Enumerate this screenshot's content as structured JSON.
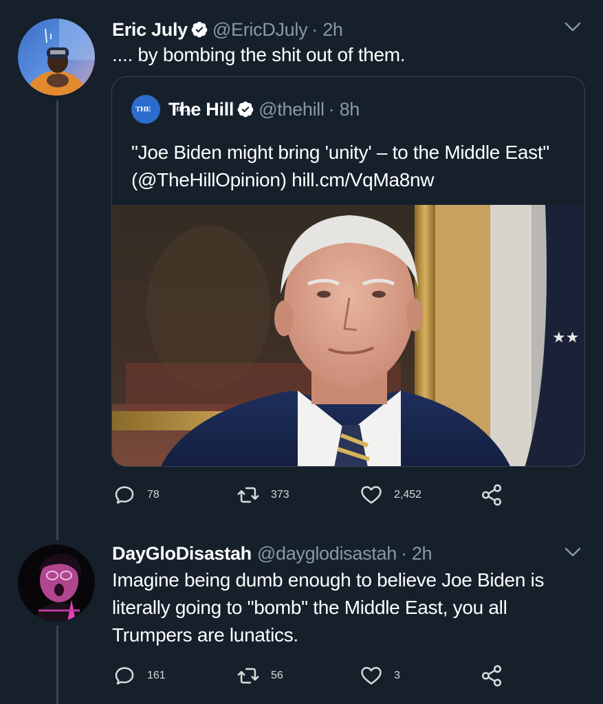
{
  "tweets": [
    {
      "display_name": "Eric July",
      "handle": "@EricDJuly",
      "time": "· 2h",
      "text": ".... by bombing the shit out of them.",
      "quote": {
        "display_name": "The Hill",
        "handle": "@thehill",
        "time": "· 8h",
        "logo_text": "THE HILL",
        "text": "\"Joe Biden might bring 'unity' – to the Middle East\" (@TheHillOpinion) hill.cm/VqMa8nw"
      },
      "replies": "78",
      "retweets": "373",
      "likes": "2,452"
    },
    {
      "display_name": "DayGloDisastah",
      "handle": "@dayglodisastah",
      "time": "· 2h",
      "text": "Imagine being dumb enough to believe Joe Biden is literally going to \"bomb\" the Middle East, you all Trumpers are lunatics.",
      "replies": "161",
      "retweets": "56",
      "likes": "3"
    }
  ],
  "colors": {
    "background": "#15202b",
    "secondary_text": "#8899a6",
    "border": "#38444d",
    "verified": "#ffffff"
  },
  "icons": [
    "reply-icon",
    "retweet-icon",
    "like-icon",
    "share-icon",
    "verified-badge-icon",
    "chevron-down-icon"
  ]
}
